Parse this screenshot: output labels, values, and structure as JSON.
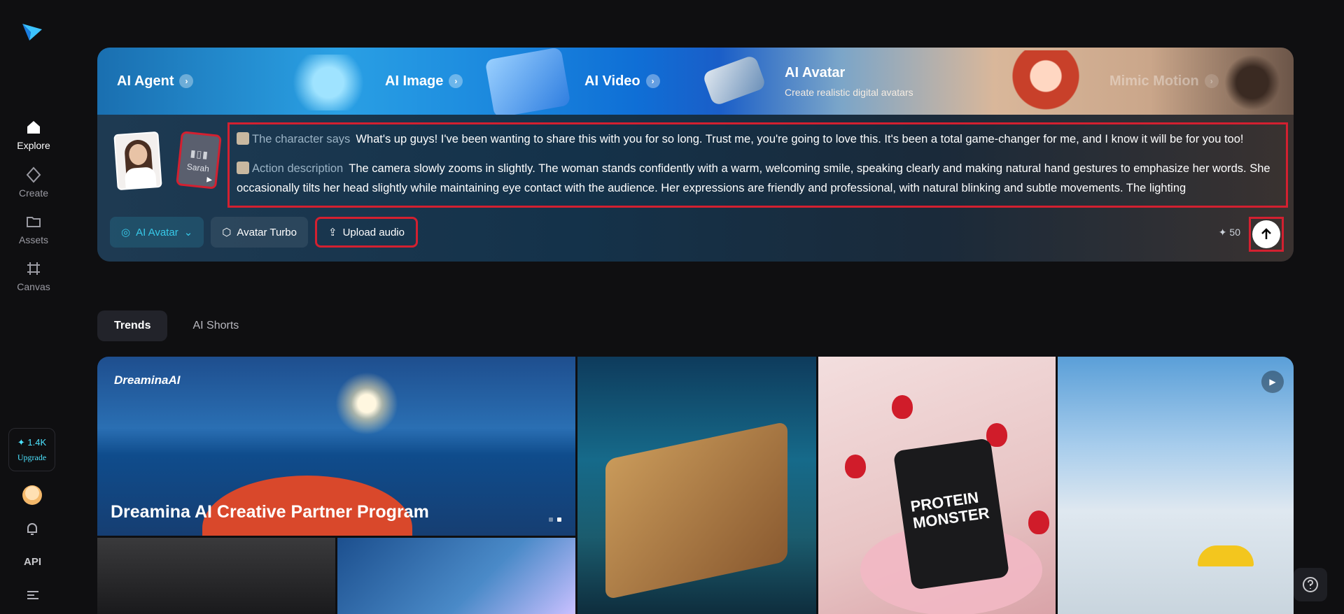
{
  "sidebar": {
    "nav": [
      {
        "label": "Explore",
        "icon": "home-icon",
        "active": true
      },
      {
        "label": "Create",
        "icon": "diamond-icon"
      },
      {
        "label": "Assets",
        "icon": "folder-icon"
      },
      {
        "label": "Canvas",
        "icon": "frame-icon"
      }
    ],
    "credits": "✦ 1.4K",
    "upgrade_label": "Upgrade",
    "api_label": "API"
  },
  "hero": {
    "tabs": [
      {
        "label": "AI Agent"
      },
      {
        "label": "AI Image"
      },
      {
        "label": "AI Video"
      },
      {
        "label": "AI Avatar",
        "subtitle": "Create realistic digital avatars",
        "active": true
      },
      {
        "label": "Mimic Motion"
      }
    ],
    "voice_name": "Sarah",
    "prompt": {
      "says_tag": "The character says",
      "says_text": "What's up guys! I've been wanting to share this with you for so long. Trust me, you're going to love this. It's been a total game-changer for me, and I know it will be for you too!",
      "action_tag": "Action description",
      "action_text": "The camera slowly zooms in slightly. The woman stands confidently with a warm, welcoming smile, speaking clearly and making natural hand gestures to emphasize her words. She occasionally tilts her head slightly while maintaining eye contact with the audience. Her expressions are friendly and professional, with natural blinking and subtle movements. The lighting"
    },
    "toolbar": {
      "mode_label": "AI Avatar",
      "model_label": "Avatar Turbo",
      "upload_label": "Upload audio",
      "cost": "✦ 50"
    }
  },
  "content_tabs": [
    {
      "label": "Trends",
      "active": true
    },
    {
      "label": "AI Shorts"
    }
  ],
  "feed": {
    "brand": "DreaminaAI",
    "featured_title": "Dreamina AI Creative Partner Program",
    "jar_label": "PROTEIN MONSTER"
  },
  "colors": {
    "accent": "#37c9e8",
    "highlight": "#d32030",
    "background": "#0f0f11"
  }
}
